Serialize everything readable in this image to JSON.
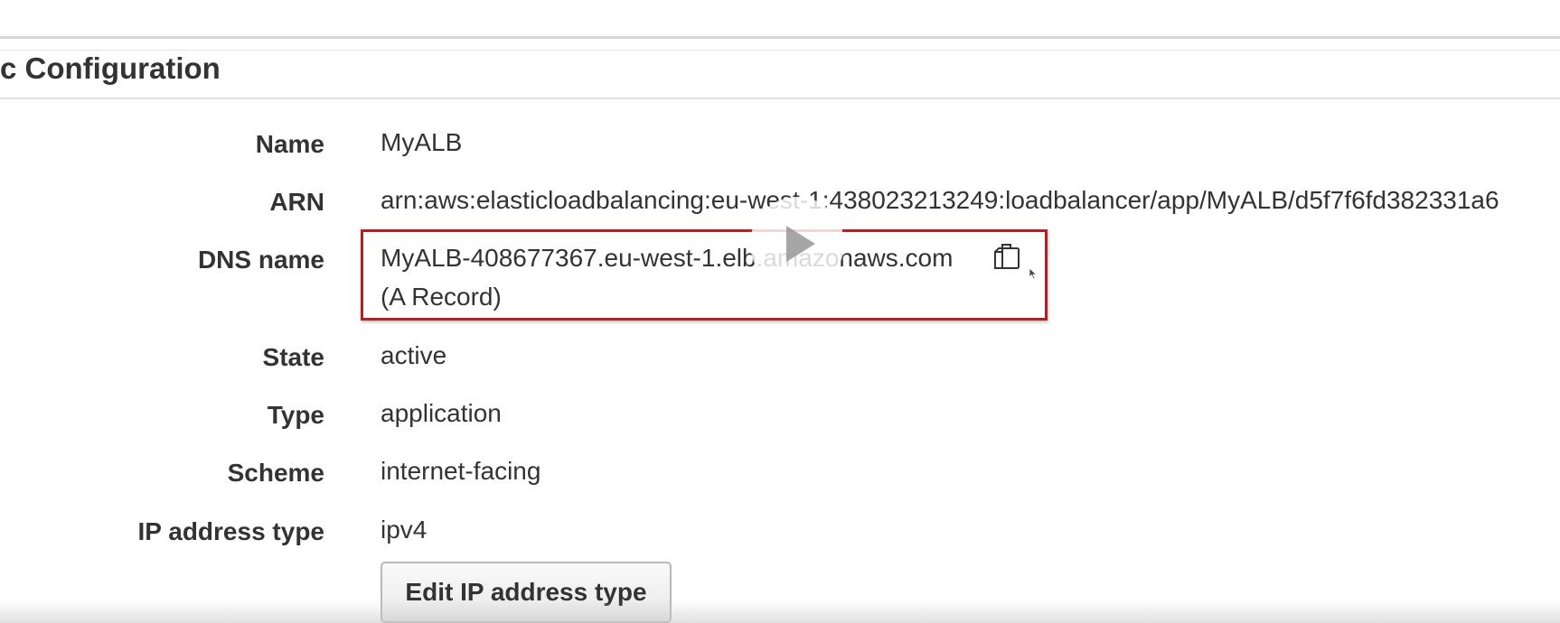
{
  "section": {
    "title": "c Configuration"
  },
  "fields": {
    "name": {
      "label": "Name",
      "value": "MyALB"
    },
    "arn": {
      "label": "ARN",
      "value": "arn:aws:elasticloadbalancing:eu-west-1:438023213249:loadbalancer/app/MyALB/d5f7f6fd382331a6"
    },
    "dns": {
      "label": "DNS name",
      "value": "MyALB-408677367.eu-west-1.elb.amazonaws.com",
      "record": "(A Record)"
    },
    "state": {
      "label": "State",
      "value": "active"
    },
    "type": {
      "label": "Type",
      "value": "application"
    },
    "scheme": {
      "label": "Scheme",
      "value": "internet-facing"
    },
    "ip_address_type": {
      "label": "IP address type",
      "value": "ipv4"
    }
  },
  "actions": {
    "edit_ip_label": "Edit IP address type"
  },
  "icons": {
    "copy": "copy-icon",
    "play": "play-icon",
    "cursor": "mouse-cursor-icon"
  },
  "colors": {
    "highlight_border": "#b32124",
    "text": "#333333"
  }
}
